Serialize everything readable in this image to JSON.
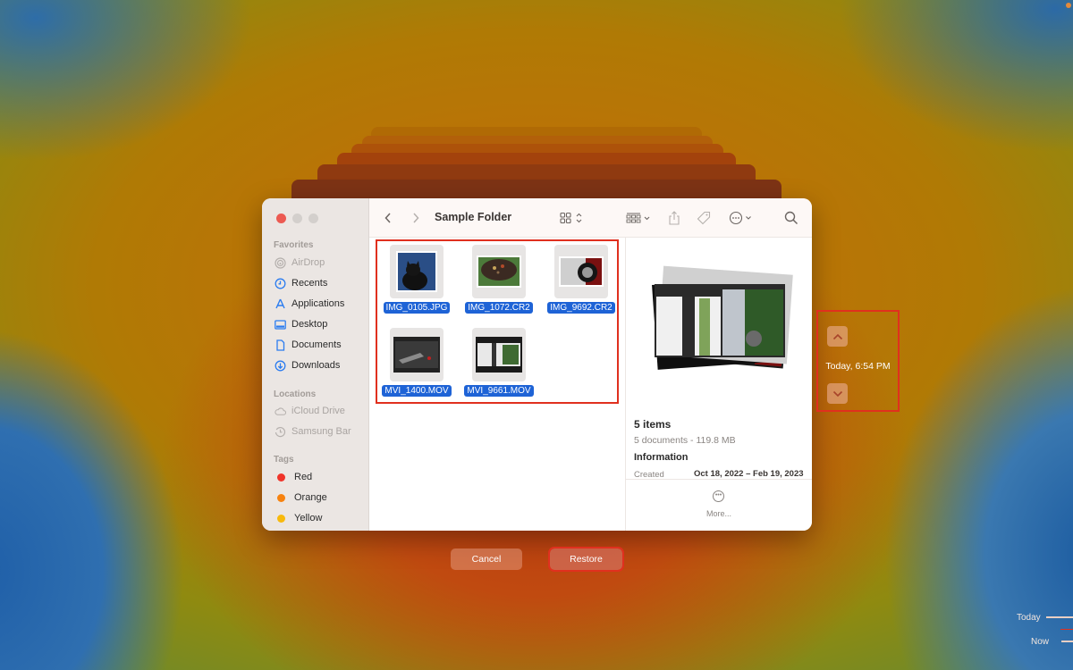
{
  "finder": {
    "title": "Sample Folder",
    "sidebar": {
      "sections": [
        {
          "label": "Favorites",
          "items": [
            {
              "label": "AirDrop",
              "icon": "airdrop-icon",
              "dim": true
            },
            {
              "label": "Recents",
              "icon": "clock-icon"
            },
            {
              "label": "Applications",
              "icon": "applications-icon"
            },
            {
              "label": "Desktop",
              "icon": "desktop-icon"
            },
            {
              "label": "Documents",
              "icon": "document-icon"
            },
            {
              "label": "Downloads",
              "icon": "download-icon"
            }
          ]
        },
        {
          "label": "Locations",
          "items": [
            {
              "label": "iCloud Drive",
              "icon": "cloud-icon",
              "dim": true
            },
            {
              "label": "Samsung Bar",
              "icon": "history-icon",
              "dim": true
            }
          ]
        },
        {
          "label": "Tags",
          "items": [
            {
              "label": "Red",
              "color": "#f0342a"
            },
            {
              "label": "Orange",
              "color": "#f7820f"
            },
            {
              "label": "Yellow",
              "color": "#f8b90c"
            }
          ]
        }
      ]
    },
    "files": [
      {
        "name": "IMG_0105.JPG"
      },
      {
        "name": "IMG_1072.CR2"
      },
      {
        "name": "IMG_9692.CR2"
      },
      {
        "name": "MVI_1400.MOV"
      },
      {
        "name": "MVI_9661.MOV"
      }
    ],
    "preview": {
      "count": "5 items",
      "summary": "5 documents - 119.8 MB",
      "info_heading": "Information",
      "created_label": "Created",
      "created_value": "Oct 18, 2022 – Feb 19, 2023",
      "more_label": "More..."
    }
  },
  "buttons": {
    "cancel": "Cancel",
    "restore": "Restore"
  },
  "navigator": {
    "time": "Today, 6:54 PM"
  },
  "timeline": {
    "today": "Today",
    "now": "Now"
  },
  "colors": {
    "selection": "#1e63d6",
    "highlight_box": "#e0301e"
  }
}
